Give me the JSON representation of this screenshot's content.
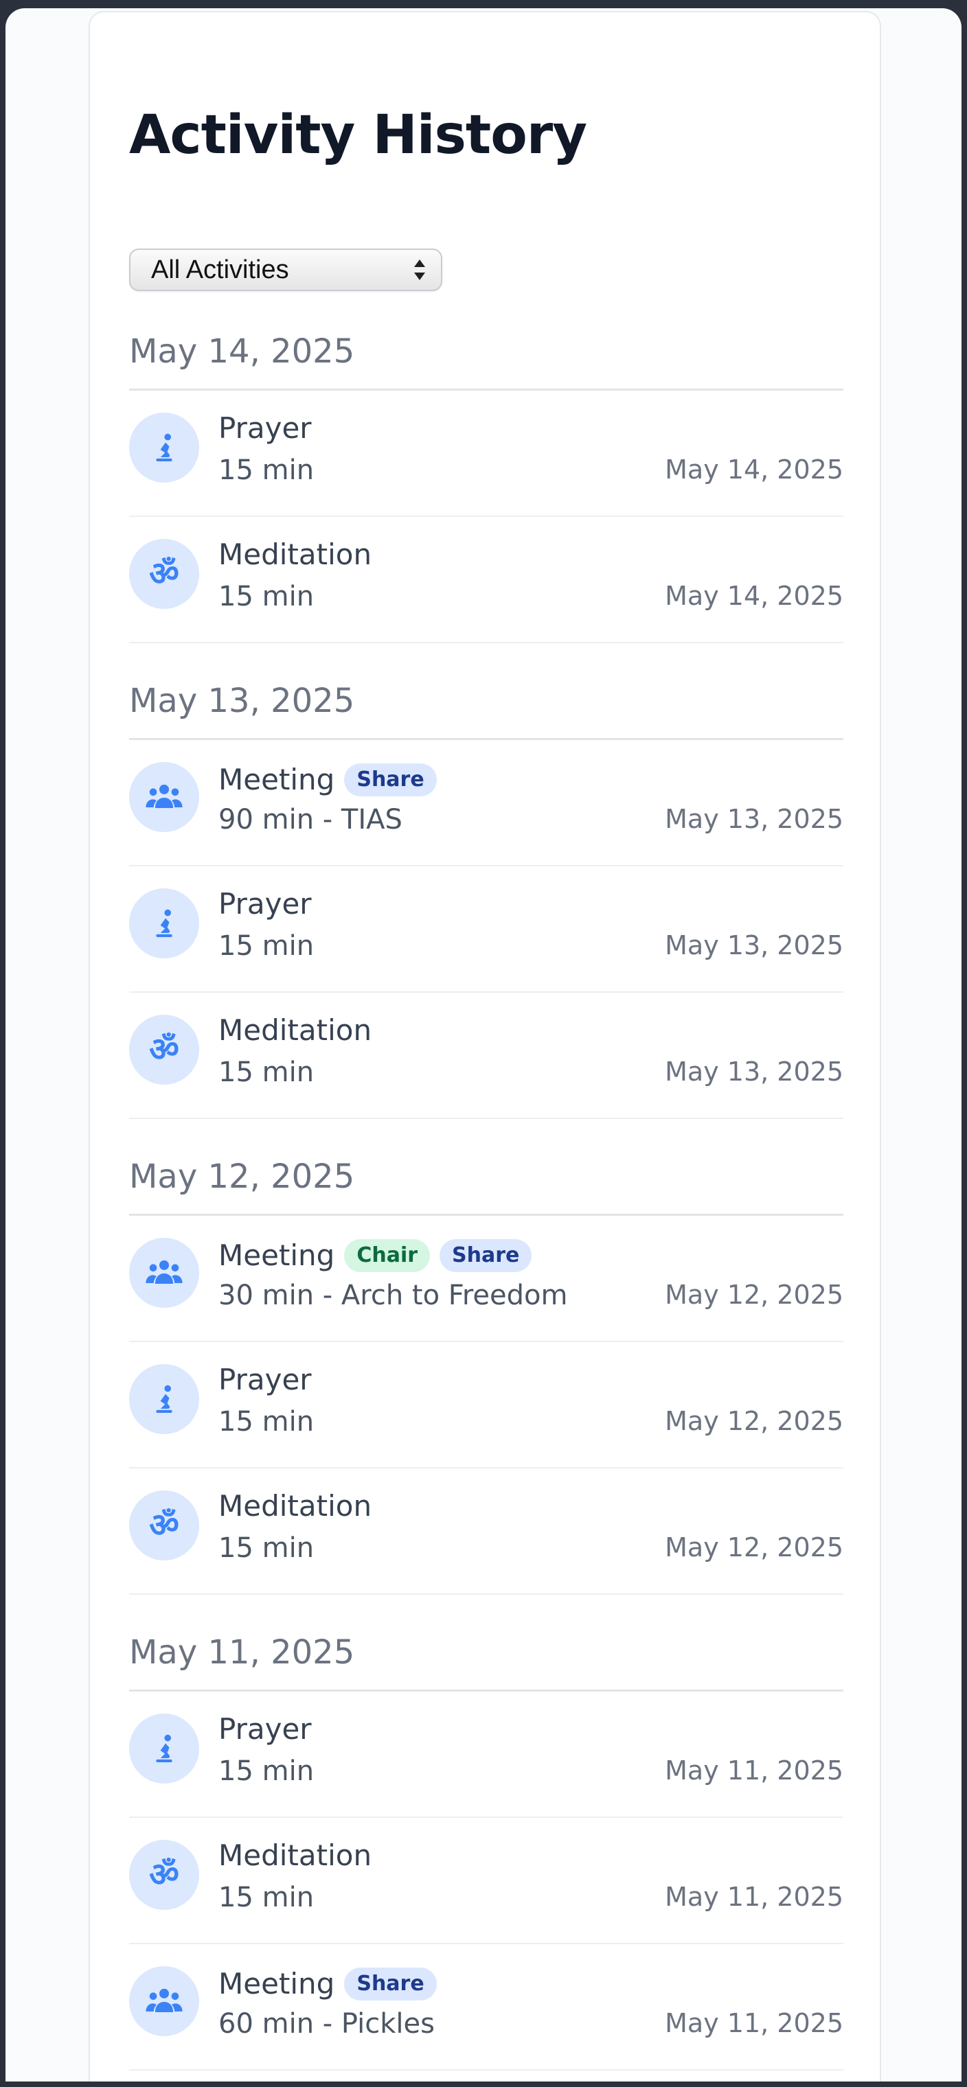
{
  "page": {
    "title": "Activity History"
  },
  "filter": {
    "selected": "All Activities"
  },
  "colors": {
    "accent": "#3b82f6",
    "icon_bg": "#dbe8fe",
    "share_badge_bg": "#dbe7fe",
    "chair_badge_bg": "#d4f6e2"
  },
  "groups": [
    {
      "date": "May 14, 2025",
      "entries": [
        {
          "type": "Prayer",
          "icon": "prayer-icon",
          "detail": "15 min",
          "date": "May 14, 2025",
          "badges": []
        },
        {
          "type": "Meditation",
          "icon": "om-icon",
          "detail": "15 min",
          "date": "May 14, 2025",
          "badges": []
        }
      ]
    },
    {
      "date": "May 13, 2025",
      "entries": [
        {
          "type": "Meeting",
          "icon": "group-icon",
          "detail": "90 min - TIAS",
          "date": "May 13, 2025",
          "badges": [
            "Share"
          ]
        },
        {
          "type": "Prayer",
          "icon": "prayer-icon",
          "detail": "15 min",
          "date": "May 13, 2025",
          "badges": []
        },
        {
          "type": "Meditation",
          "icon": "om-icon",
          "detail": "15 min",
          "date": "May 13, 2025",
          "badges": []
        }
      ]
    },
    {
      "date": "May 12, 2025",
      "entries": [
        {
          "type": "Meeting",
          "icon": "group-icon",
          "detail": "30 min - Arch to Freedom",
          "date": "May 12, 2025",
          "badges": [
            "Chair",
            "Share"
          ]
        },
        {
          "type": "Prayer",
          "icon": "prayer-icon",
          "detail": "15 min",
          "date": "May 12, 2025",
          "badges": []
        },
        {
          "type": "Meditation",
          "icon": "om-icon",
          "detail": "15 min",
          "date": "May 12, 2025",
          "badges": []
        }
      ]
    },
    {
      "date": "May 11, 2025",
      "entries": [
        {
          "type": "Prayer",
          "icon": "prayer-icon",
          "detail": "15 min",
          "date": "May 11, 2025",
          "badges": []
        },
        {
          "type": "Meditation",
          "icon": "om-icon",
          "detail": "15 min",
          "date": "May 11, 2025",
          "badges": []
        },
        {
          "type": "Meeting",
          "icon": "group-icon",
          "detail": "60 min - Pickles",
          "date": "May 11, 2025",
          "badges": [
            "Share"
          ]
        }
      ]
    }
  ]
}
